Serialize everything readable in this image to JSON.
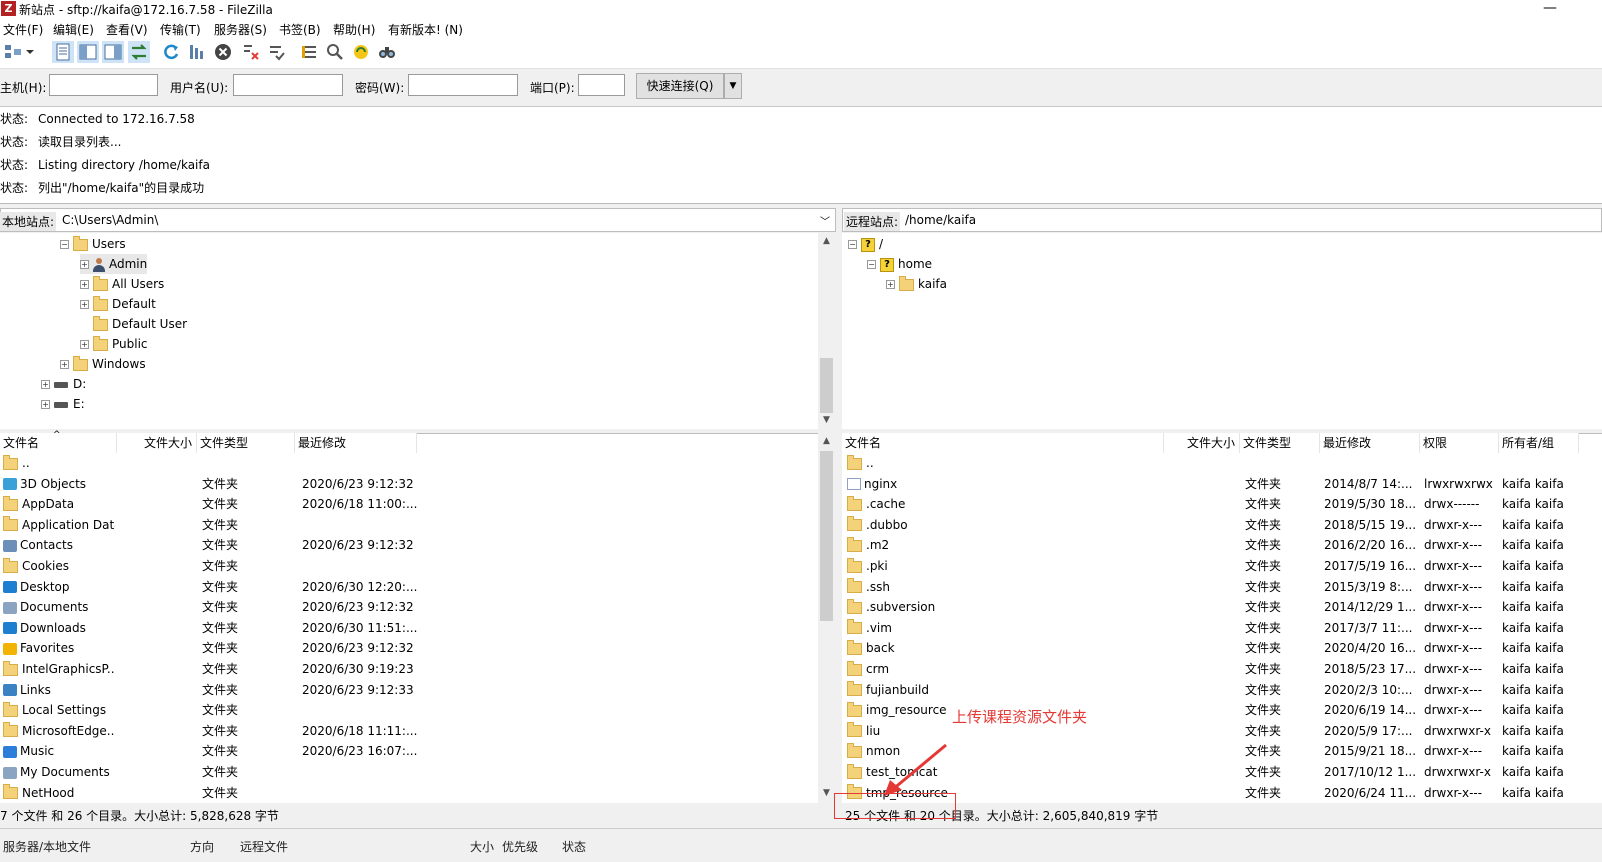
{
  "window": {
    "title": "新站点 - sftp://kaifa@172.16.7.58 - FileZilla",
    "app_icon": "Z",
    "minimize": "—"
  },
  "menu": [
    "文件(F)",
    "编辑(E)",
    "查看(V)",
    "传输(T)",
    "服务器(S)",
    "书签(B)",
    "帮助(H)",
    "有新版本! (N)"
  ],
  "quickconnect": {
    "host_label": "主机(H):",
    "user_label": "用户名(U):",
    "pass_label": "密码(W):",
    "port_label": "端口(P):",
    "host_value": "",
    "user_value": "",
    "pass_value": "",
    "port_value": "",
    "button": "快速连接(Q)"
  },
  "log": [
    {
      "key": "状态:",
      "msg": "Connected to 172.16.7.58"
    },
    {
      "key": "状态:",
      "msg": "读取目录列表..."
    },
    {
      "key": "状态:",
      "msg": "Listing directory /home/kaifa"
    },
    {
      "key": "状态:",
      "msg": "列出\"/home/kaifa\"的目录成功"
    }
  ],
  "local": {
    "site_label": "本地站点:",
    "path": "C:\\Users\\Admin\\",
    "tree": [
      "Users",
      "Admin",
      "All Users",
      "Default",
      "Default User",
      "Public",
      "Windows",
      "D:",
      "E:"
    ],
    "columns": [
      "文件名",
      "文件大小",
      "文件类型",
      "最近修改"
    ],
    "files": [
      {
        "name": "..",
        "type": "",
        "modified": ""
      },
      {
        "name": "3D Objects",
        "type": "文件夹",
        "modified": "2020/6/23 9:12:32"
      },
      {
        "name": "AppData",
        "type": "文件夹",
        "modified": "2020/6/18 11:00:..."
      },
      {
        "name": "Application Data",
        "type": "文件夹",
        "modified": ""
      },
      {
        "name": "Contacts",
        "type": "文件夹",
        "modified": "2020/6/23 9:12:32"
      },
      {
        "name": "Cookies",
        "type": "文件夹",
        "modified": ""
      },
      {
        "name": "Desktop",
        "type": "文件夹",
        "modified": "2020/6/30 12:20:..."
      },
      {
        "name": "Documents",
        "type": "文件夹",
        "modified": "2020/6/23 9:12:32"
      },
      {
        "name": "Downloads",
        "type": "文件夹",
        "modified": "2020/6/30 11:51:..."
      },
      {
        "name": "Favorites",
        "type": "文件夹",
        "modified": "2020/6/23 9:12:32"
      },
      {
        "name": "IntelGraphicsP...",
        "type": "文件夹",
        "modified": "2020/6/30 9:19:23"
      },
      {
        "name": "Links",
        "type": "文件夹",
        "modified": "2020/6/23 9:12:33"
      },
      {
        "name": "Local Settings",
        "type": "文件夹",
        "modified": ""
      },
      {
        "name": "MicrosoftEdge...",
        "type": "文件夹",
        "modified": "2020/6/18 11:11:..."
      },
      {
        "name": "Music",
        "type": "文件夹",
        "modified": "2020/6/23 16:07:..."
      },
      {
        "name": "My Documents",
        "type": "文件夹",
        "modified": ""
      },
      {
        "name": "NetHood",
        "type": "文件夹",
        "modified": ""
      }
    ],
    "status": "7 个文件 和 26 个目录。大小总计: 5,828,628 字节"
  },
  "remote": {
    "site_label": "远程站点:",
    "path": "/home/kaifa",
    "tree": [
      "/",
      "home",
      "kaifa"
    ],
    "columns": [
      "文件名",
      "文件大小",
      "文件类型",
      "最近修改",
      "权限",
      "所有者/组"
    ],
    "files": [
      {
        "name": "..",
        "type": "",
        "modified": "",
        "perm": "",
        "owner": ""
      },
      {
        "name": "nginx",
        "type": "文件夹",
        "modified": "2014/8/7 14:...",
        "perm": "lrwxrwxrwx",
        "owner": "kaifa kaifa"
      },
      {
        "name": ".cache",
        "type": "文件夹",
        "modified": "2019/5/30 18...",
        "perm": "drwx------",
        "owner": "kaifa kaifa"
      },
      {
        "name": ".dubbo",
        "type": "文件夹",
        "modified": "2018/5/15 19...",
        "perm": "drwxr-x---",
        "owner": "kaifa kaifa"
      },
      {
        "name": ".m2",
        "type": "文件夹",
        "modified": "2016/2/20 16...",
        "perm": "drwxr-x---",
        "owner": "kaifa kaifa"
      },
      {
        "name": ".pki",
        "type": "文件夹",
        "modified": "2017/5/19 16...",
        "perm": "drwxr-x---",
        "owner": "kaifa kaifa"
      },
      {
        "name": ".ssh",
        "type": "文件夹",
        "modified": "2015/3/19 8:...",
        "perm": "drwxr-x---",
        "owner": "kaifa kaifa"
      },
      {
        "name": ".subversion",
        "type": "文件夹",
        "modified": "2014/12/29 1...",
        "perm": "drwxr-x---",
        "owner": "kaifa kaifa"
      },
      {
        "name": ".vim",
        "type": "文件夹",
        "modified": "2017/3/7 11:...",
        "perm": "drwxr-x---",
        "owner": "kaifa kaifa"
      },
      {
        "name": "back",
        "type": "文件夹",
        "modified": "2020/4/20 16...",
        "perm": "drwxr-x---",
        "owner": "kaifa kaifa"
      },
      {
        "name": "crm",
        "type": "文件夹",
        "modified": "2018/5/23 17...",
        "perm": "drwxr-x---",
        "owner": "kaifa kaifa"
      },
      {
        "name": "fujianbuild",
        "type": "文件夹",
        "modified": "2020/2/3 10:...",
        "perm": "drwxr-x---",
        "owner": "kaifa kaifa"
      },
      {
        "name": "img_resource",
        "type": "文件夹",
        "modified": "2020/6/19 14...",
        "perm": "drwxr-x---",
        "owner": "kaifa kaifa"
      },
      {
        "name": "liu",
        "type": "文件夹",
        "modified": "2020/5/9 17:...",
        "perm": "drwxrwxr-x",
        "owner": "kaifa kaifa"
      },
      {
        "name": "nmon",
        "type": "文件夹",
        "modified": "2015/9/21 18...",
        "perm": "drwxr-x---",
        "owner": "kaifa kaifa"
      },
      {
        "name": "test_tomcat",
        "type": "文件夹",
        "modified": "2017/10/12 1...",
        "perm": "drwxrwxr-x",
        "owner": "kaifa kaifa"
      },
      {
        "name": "tmp_resource",
        "type": "文件夹",
        "modified": "2020/6/24 11...",
        "perm": "drwxr-x---",
        "owner": "kaifa kaifa"
      }
    ],
    "status": "25 个文件 和 20 个目录。大小总计: 2,605,840,819 字节"
  },
  "bottom_tabs": [
    "服务器/本地文件",
    "方向",
    "远程文件",
    "大小",
    "优先级",
    "状态"
  ],
  "annotation": {
    "text": "上传课程资源文件夹",
    "color": "#e53935"
  }
}
